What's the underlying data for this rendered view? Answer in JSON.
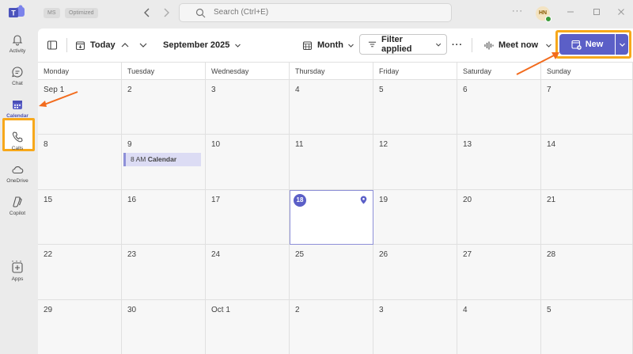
{
  "titlebar": {
    "badges": [
      "MS",
      "Optimized"
    ],
    "search_placeholder": "Search (Ctrl+E)",
    "more": "···",
    "avatar_initials": "HN"
  },
  "rail": {
    "items": [
      {
        "label": "Activity",
        "icon": "bell-icon"
      },
      {
        "label": "Chat",
        "icon": "chat-icon"
      },
      {
        "label": "Calendar",
        "icon": "calendar-icon",
        "active": true
      },
      {
        "label": "Calls",
        "icon": "phone-icon"
      },
      {
        "label": "OneDrive",
        "icon": "cloud-icon"
      },
      {
        "label": "Copilot",
        "icon": "copilot-icon"
      }
    ],
    "more": "···",
    "apps_label": "Apps"
  },
  "toolbar": {
    "today_label": "Today",
    "month_year": "September 2025",
    "view_label": "Month",
    "filter_label": "Filter applied",
    "more": "···",
    "meet_now_label": "Meet now",
    "new_label": "New"
  },
  "calendar": {
    "days": [
      "Monday",
      "Tuesday",
      "Wednesday",
      "Thursday",
      "Friday",
      "Saturday",
      "Sunday"
    ],
    "weeks": [
      [
        "Sep 1",
        "2",
        "3",
        "4",
        "5",
        "6",
        "7"
      ],
      [
        "8",
        "9",
        "10",
        "11",
        "12",
        "13",
        "14"
      ],
      [
        "15",
        "16",
        "17",
        "18",
        "19",
        "20",
        "21"
      ],
      [
        "22",
        "23",
        "24",
        "25",
        "26",
        "27",
        "28"
      ],
      [
        "29",
        "30",
        "Oct 1",
        "2",
        "3",
        "4",
        "5"
      ]
    ],
    "today": "18",
    "event": {
      "time": "8 AM",
      "title": "Calendar"
    }
  },
  "colors": {
    "accent": "#5b5fc7",
    "highlight": "#f7a81b",
    "arrow": "#f26b1d"
  }
}
